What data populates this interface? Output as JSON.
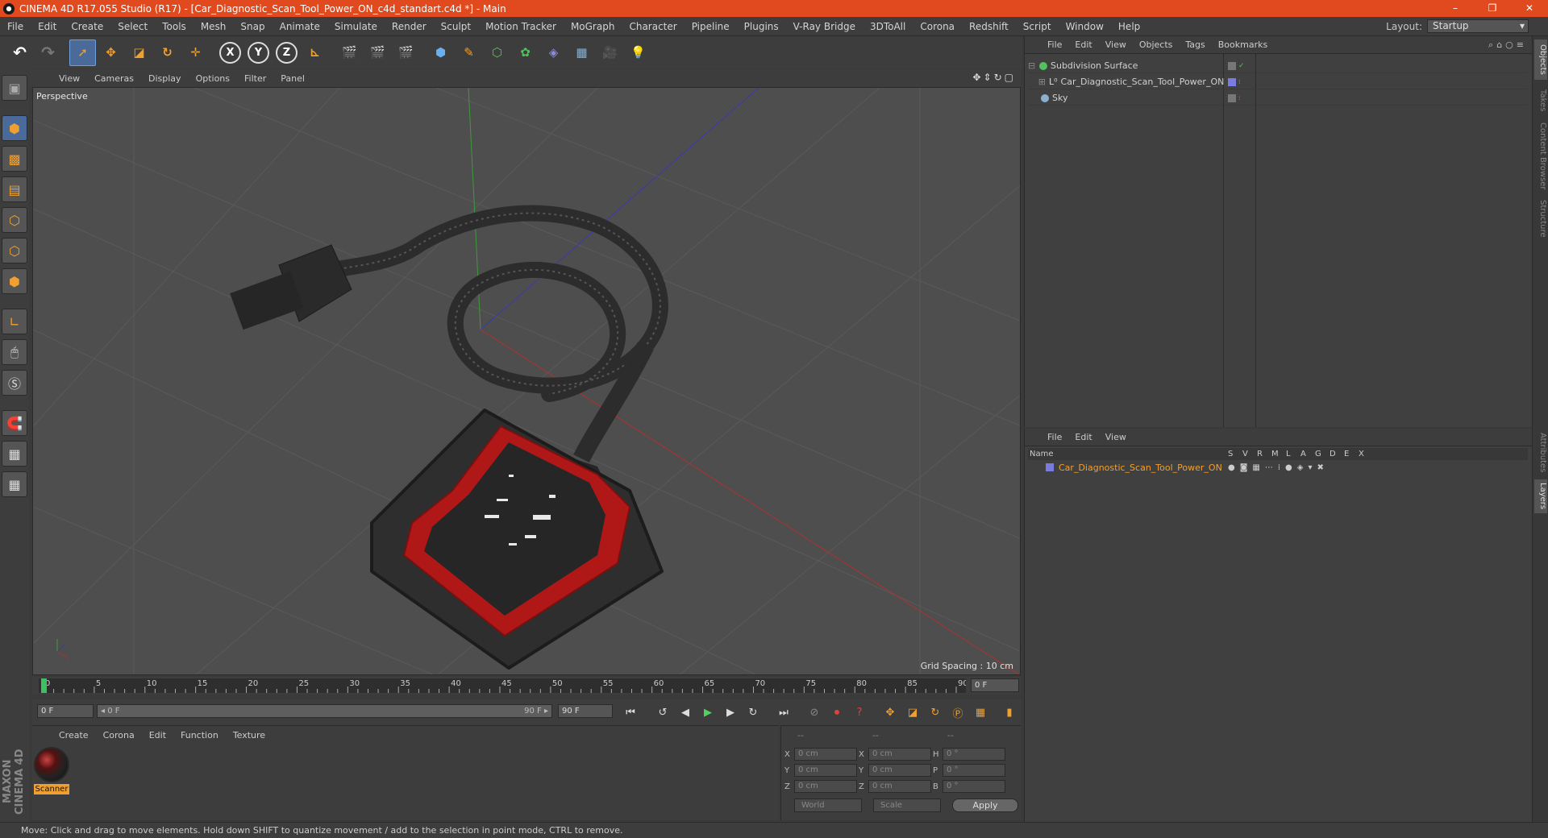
{
  "window": {
    "title": "CINEMA 4D R17.055 Studio (R17) - [Car_Diagnostic_Scan_Tool_Power_ON_c4d_standart.c4d *] - Main",
    "controls": [
      "–",
      "❐",
      "✕"
    ]
  },
  "menubar": {
    "items": [
      "File",
      "Edit",
      "Create",
      "Select",
      "Tools",
      "Mesh",
      "Snap",
      "Animate",
      "Simulate",
      "Render",
      "Sculpt",
      "Motion Tracker",
      "MoGraph",
      "Character",
      "Pipeline",
      "Plugins",
      "V-Ray Bridge",
      "3DToAll",
      "Corona",
      "Redshift",
      "Script",
      "Window",
      "Help"
    ],
    "layout_label": "Layout:",
    "layout_value": "Startup"
  },
  "viewport": {
    "menu": [
      "View",
      "Cameras",
      "Display",
      "Options",
      "Filter",
      "Panel"
    ],
    "label": "Perspective",
    "grid_spacing": "Grid Spacing : 10 cm"
  },
  "timeline": {
    "ticks": [
      "0",
      "5",
      "10",
      "15",
      "20",
      "25",
      "30",
      "35",
      "40",
      "45",
      "50",
      "55",
      "60",
      "65",
      "70",
      "75",
      "80",
      "85",
      "90"
    ],
    "end_frame": "0 F"
  },
  "transport": {
    "start": "0 F",
    "slider_left": "◂ 0 F",
    "slider_right": "90 F ▸",
    "end": "90 F"
  },
  "material_panel": {
    "menu": [
      "Create",
      "Corona",
      "Edit",
      "Function",
      "Texture"
    ],
    "material_name": "Scanner"
  },
  "coordinates": {
    "headers": [
      "--",
      "--",
      "--"
    ],
    "rows": [
      {
        "a": "X",
        "v1": "0 cm",
        "b": "X",
        "v2": "0 cm",
        "c": "H",
        "v3": "0 °"
      },
      {
        "a": "Y",
        "v1": "0 cm",
        "b": "Y",
        "v2": "0 cm",
        "c": "P",
        "v3": "0 °"
      },
      {
        "a": "Z",
        "v1": "0 cm",
        "b": "Z",
        "v2": "0 cm",
        "c": "B",
        "v3": "0 °"
      }
    ],
    "mode": "World",
    "scale_mode": "Scale",
    "apply": "Apply"
  },
  "object_manager": {
    "menu": [
      "File",
      "Edit",
      "View",
      "Objects",
      "Tags",
      "Bookmarks"
    ],
    "objects": [
      {
        "name": "Subdivision Surface",
        "color": "#55c060"
      },
      {
        "name": "Car_Diagnostic_Scan_Tool_Power_ON",
        "color": "#7a7adf"
      },
      {
        "name": "Sky",
        "color": "#8ab0d0"
      }
    ]
  },
  "layer_manager": {
    "menu": [
      "File",
      "Edit",
      "View"
    ],
    "columns": [
      "Name",
      "S",
      "V",
      "R",
      "M",
      "L",
      "A",
      "G",
      "D",
      "E",
      "X"
    ],
    "layers": [
      {
        "name": "Car_Diagnostic_Scan_Tool_Power_ON",
        "color": "#7a7adf"
      }
    ]
  },
  "side_tabs": [
    "Objects",
    "Takes",
    "Content Browser",
    "Structure",
    "Attributes",
    "Layers"
  ],
  "status": "Move: Click and drag to move elements. Hold down SHIFT to quantize movement / add to the selection in point mode, CTRL to remove.",
  "branding": "MAXON CINEMA 4D"
}
